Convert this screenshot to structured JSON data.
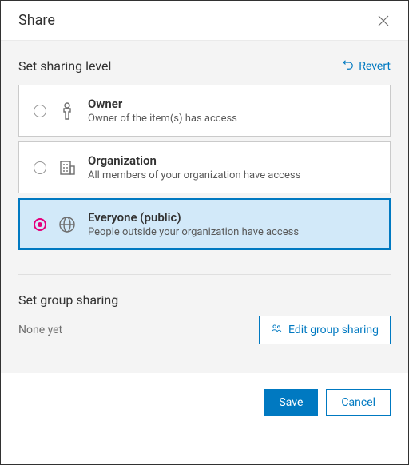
{
  "dialog": {
    "title": "Share"
  },
  "sharing": {
    "section_title": "Set sharing level",
    "revert_label": "Revert",
    "selected_index": 2,
    "options": [
      {
        "title": "Owner",
        "desc": "Owner of the item(s) has access",
        "icon": "person-icon"
      },
      {
        "title": "Organization",
        "desc": "All members of your organization have access",
        "icon": "org-icon"
      },
      {
        "title": "Everyone (public)",
        "desc": "People outside your organization have access",
        "icon": "globe-icon"
      }
    ]
  },
  "groups": {
    "section_title": "Set group sharing",
    "empty_text": "None yet",
    "edit_label": "Edit group sharing"
  },
  "footer": {
    "save_label": "Save",
    "cancel_label": "Cancel"
  },
  "colors": {
    "accent": "#0079c1",
    "magenta": "#e4007c"
  }
}
